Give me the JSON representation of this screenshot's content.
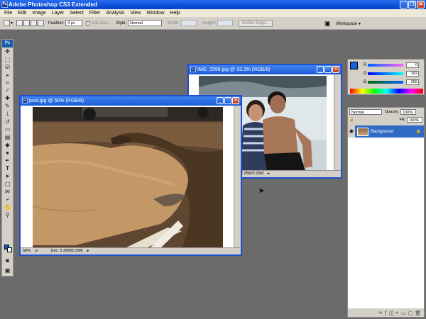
{
  "window": {
    "title": "Adobe Photoshop CS3 Extended",
    "ps_logo": "Ps"
  },
  "menu": [
    "File",
    "Edit",
    "Image",
    "Layer",
    "Select",
    "Filter",
    "Analysis",
    "View",
    "Window",
    "Help"
  ],
  "options": {
    "feather_label": "Feather:",
    "feather_value": "0 px",
    "antialias_label": "Anti-alias",
    "style_label": "Style:",
    "style_value": "Normal",
    "width_label": "Width:",
    "height_label": "Height:",
    "refine_edge": "Refine Edge...",
    "workspace": "Workspace ▾"
  },
  "documents": {
    "front": {
      "title": "pool.jpg @ 50% (RGB/8)",
      "zoom": "50%",
      "doc_info": "Doc: 2.25M/2.25M"
    },
    "back": {
      "title": "IMG_2596.jpg @ 33.3% (RGB/8)",
      "doc_info": "2.25M/2.25M"
    }
  },
  "color_panel": {
    "r": {
      "label": "R",
      "value": "0"
    },
    "g": {
      "label": "G",
      "value": "102"
    },
    "b": {
      "label": "B",
      "value": "255"
    },
    "foreground": "#0066ff"
  },
  "layers_panel": {
    "blend_mode": "Normal",
    "opacity_label": "Opacity:",
    "opacity_value": "100%",
    "fill_label": "Fill:",
    "fill_value": "100%",
    "layer_name": "Background"
  },
  "icons": {
    "app": "photoshop-icon",
    "eye": "eye-icon",
    "lock": "lock-icon",
    "minimize": "minimize-icon",
    "maximize": "maximize-icon",
    "close": "close-icon"
  }
}
